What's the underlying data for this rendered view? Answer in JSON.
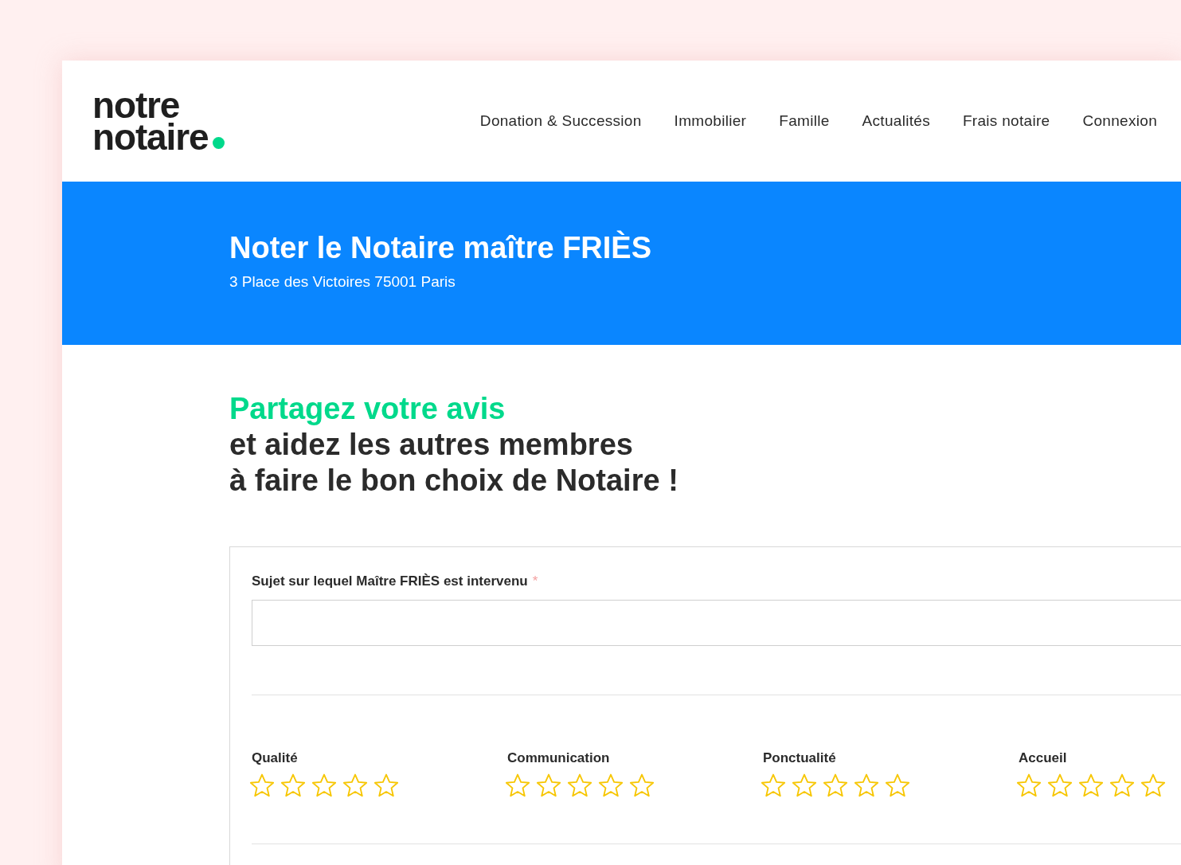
{
  "logo": {
    "line_1": "notre",
    "line_2": "notaire"
  },
  "nav": [
    "Donation & Succession",
    "Immobilier",
    "Famille",
    "Actualités",
    "Frais notaire",
    "Connexion"
  ],
  "banner": {
    "title": "Noter le Notaire maître FRIÈS",
    "address": "3 Place des Victoires 75001 Paris"
  },
  "intro": {
    "highlight": "Partagez votre avis",
    "line_2": "et aidez les autres membres",
    "line_3": "à faire le bon choix de Notaire !"
  },
  "form": {
    "subject_label": "Sujet sur lequel Maître FRIÈS est intervenu",
    "required_mark": "*",
    "ratings": [
      {
        "label": "Qualité",
        "stars": 0
      },
      {
        "label": "Communication",
        "stars": 0
      },
      {
        "label": "Ponctualité",
        "stars": 0
      },
      {
        "label": "Accueil",
        "stars": 0
      }
    ]
  }
}
